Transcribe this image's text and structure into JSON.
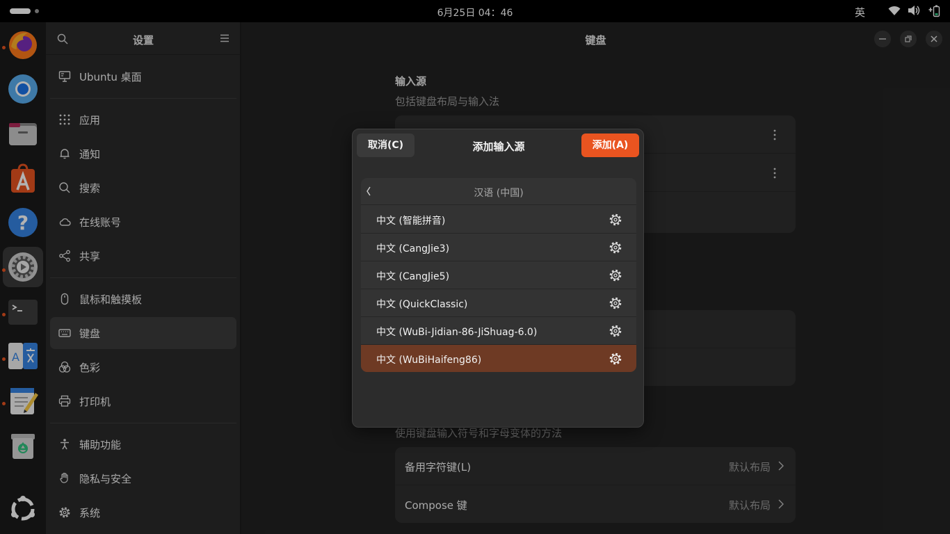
{
  "topbar": {
    "clock": "6月25日  04：46",
    "input_indicator": "英"
  },
  "dock": {
    "apps": [
      {
        "name": "Firefox",
        "icon": "firefox-icon",
        "running": true
      },
      {
        "name": "Chromium",
        "icon": "chromium-icon",
        "running": false
      },
      {
        "name": "文件",
        "icon": "files-icon",
        "running": false
      },
      {
        "name": "App Center",
        "icon": "app-center-icon",
        "running": false
      },
      {
        "name": "帮助",
        "icon": "help-icon",
        "running": false
      },
      {
        "name": "设置",
        "icon": "settings-icon",
        "running": true,
        "active": true
      },
      {
        "name": "终端",
        "icon": "terminal-icon",
        "running": true
      },
      {
        "name": "语言",
        "icon": "language-icon",
        "running": true
      },
      {
        "name": "文本编辑器",
        "icon": "text-editor-icon",
        "running": true
      },
      {
        "name": "回收站",
        "icon": "trash-icon",
        "running": false
      },
      {
        "name": "显示应用程序",
        "icon": "show-apps-icon",
        "running": false
      }
    ]
  },
  "sidebar": {
    "title": "设置",
    "items": [
      {
        "label": "Ubuntu 桌面",
        "icon": "desktop-icon"
      },
      {
        "label": "应用",
        "icon": "apps-grid-icon"
      },
      {
        "label": "通知",
        "icon": "bell-icon"
      },
      {
        "label": "搜索",
        "icon": "search-icon"
      },
      {
        "label": "在线账号",
        "icon": "cloud-icon"
      },
      {
        "label": "共享",
        "icon": "share-icon"
      },
      {
        "label": "鼠标和触摸板",
        "icon": "mouse-icon"
      },
      {
        "label": "键盘",
        "icon": "keyboard-icon",
        "selected": true
      },
      {
        "label": "色彩",
        "icon": "color-icon"
      },
      {
        "label": "打印机",
        "icon": "printer-icon"
      },
      {
        "label": "辅助功能",
        "icon": "accessibility-icon"
      },
      {
        "label": "隐私与安全",
        "icon": "hand-icon"
      },
      {
        "label": "系统",
        "icon": "system-gear-icon"
      }
    ]
  },
  "main": {
    "title": "键盘",
    "input_sources": {
      "title": "输入源",
      "subtitle": "包括键盘布局与输入法"
    },
    "special_chars": {
      "subtitle": "使用键盘输入符号和字母变体的方法",
      "rows": [
        {
          "label": "备用字符键(L)",
          "value": "默认布局"
        },
        {
          "label": "Compose 键",
          "value": "默认布局"
        }
      ]
    }
  },
  "dialog": {
    "cancel_label": "取消(C)",
    "title": "添加输入源",
    "add_label": "添加(A)",
    "language": "汉语 (中国)",
    "sources": [
      {
        "label": "中文 (智能拼音)"
      },
      {
        "label": "中文 (CangJie3)"
      },
      {
        "label": "中文 (CangJie5)"
      },
      {
        "label": "中文 (QuickClassic)"
      },
      {
        "label": "中文 (WuBi-Jidian-86-JiShuag-6.0)"
      },
      {
        "label": "中文 (WuBiHaifeng86)",
        "selected": true
      }
    ]
  },
  "colors": {
    "accent": "#e95420",
    "selection": "#6e3a24"
  }
}
